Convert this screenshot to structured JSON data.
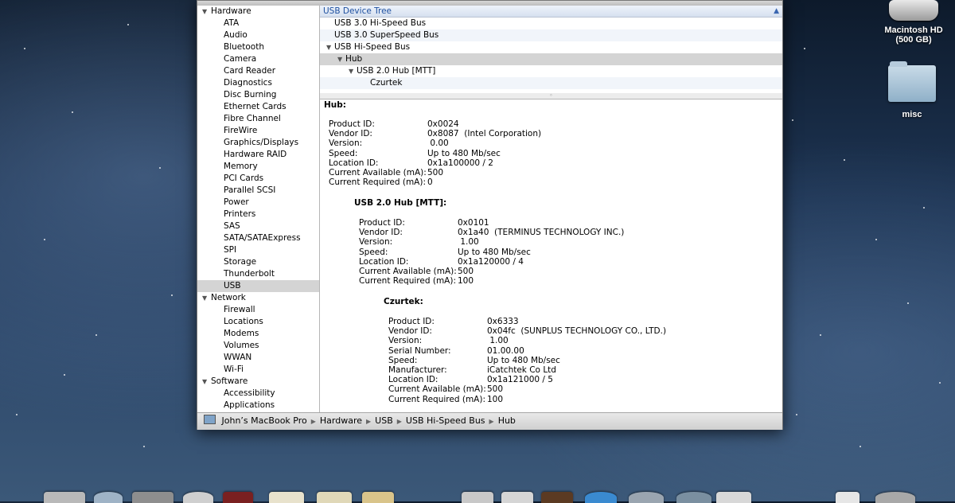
{
  "desktop": {
    "hd_label": "Macintosh HD",
    "hd_size": "(500 GB)",
    "folder_label": "misc"
  },
  "sidebar": {
    "groups": [
      {
        "label": "Hardware",
        "items": [
          "ATA",
          "Audio",
          "Bluetooth",
          "Camera",
          "Card Reader",
          "Diagnostics",
          "Disc Burning",
          "Ethernet Cards",
          "Fibre Channel",
          "FireWire",
          "Graphics/Displays",
          "Hardware RAID",
          "Memory",
          "PCI Cards",
          "Parallel SCSI",
          "Power",
          "Printers",
          "SAS",
          "SATA/SATAExpress",
          "SPI",
          "Storage",
          "Thunderbolt",
          "USB"
        ]
      },
      {
        "label": "Network",
        "items": [
          "Firewall",
          "Locations",
          "Modems",
          "Volumes",
          "WWAN",
          "Wi-Fi"
        ]
      },
      {
        "label": "Software",
        "items": [
          "Accessibility",
          "Applications"
        ]
      }
    ],
    "selected": "USB"
  },
  "tree": {
    "header": "USB Device Tree",
    "rows": [
      "USB 3.0 Hi-Speed Bus",
      "USB 3.0 SuperSpeed Bus",
      "USB Hi-Speed Bus",
      "Hub",
      "USB 2.0 Hub [MTT]",
      "Czurtek"
    ]
  },
  "details": {
    "hub": {
      "title": "Hub:",
      "fields": [
        {
          "k": "Product ID:",
          "v": "0x0024"
        },
        {
          "k": "Vendor ID:",
          "v": "0x8087  (Intel Corporation)"
        },
        {
          "k": "Version:",
          "v": " 0.00"
        },
        {
          "k": "Speed:",
          "v": "Up to 480 Mb/sec"
        },
        {
          "k": "Location ID:",
          "v": "0x1a100000 / 2"
        },
        {
          "k": "Current Available (mA):",
          "v": "500"
        },
        {
          "k": "Current Required (mA):",
          "v": "0"
        }
      ]
    },
    "usb20hub": {
      "title": "USB 2.0 Hub [MTT]:",
      "fields": [
        {
          "k": "Product ID:",
          "v": "0x0101"
        },
        {
          "k": "Vendor ID:",
          "v": "0x1a40  (TERMINUS TECHNOLOGY INC.)"
        },
        {
          "k": "Version:",
          "v": " 1.00"
        },
        {
          "k": "Speed:",
          "v": "Up to 480 Mb/sec"
        },
        {
          "k": "Location ID:",
          "v": "0x1a120000 / 4"
        },
        {
          "k": "Current Available (mA):",
          "v": "500"
        },
        {
          "k": "Current Required (mA):",
          "v": "100"
        }
      ]
    },
    "czurtek": {
      "title": "Czurtek:",
      "fields": [
        {
          "k": "Product ID:",
          "v": "0x6333"
        },
        {
          "k": "Vendor ID:",
          "v": "0x04fc  (SUNPLUS TECHNOLOGY CO., LTD.)"
        },
        {
          "k": "Version:",
          "v": " 1.00"
        },
        {
          "k": "Serial Number:",
          "v": "01.00.00"
        },
        {
          "k": "Speed:",
          "v": "Up to 480 Mb/sec"
        },
        {
          "k": "Manufacturer:",
          "v": "iCatchtek Co Ltd"
        },
        {
          "k": "Location ID:",
          "v": "0x1a121000 / 5"
        },
        {
          "k": "Current Available (mA):",
          "v": "500"
        },
        {
          "k": "Current Required (mA):",
          "v": "100"
        }
      ]
    }
  },
  "statusbar": {
    "crumbs": [
      "John’s MacBook Pro",
      "Hardware",
      "USB",
      "USB Hi-Speed Bus",
      "Hub"
    ]
  }
}
